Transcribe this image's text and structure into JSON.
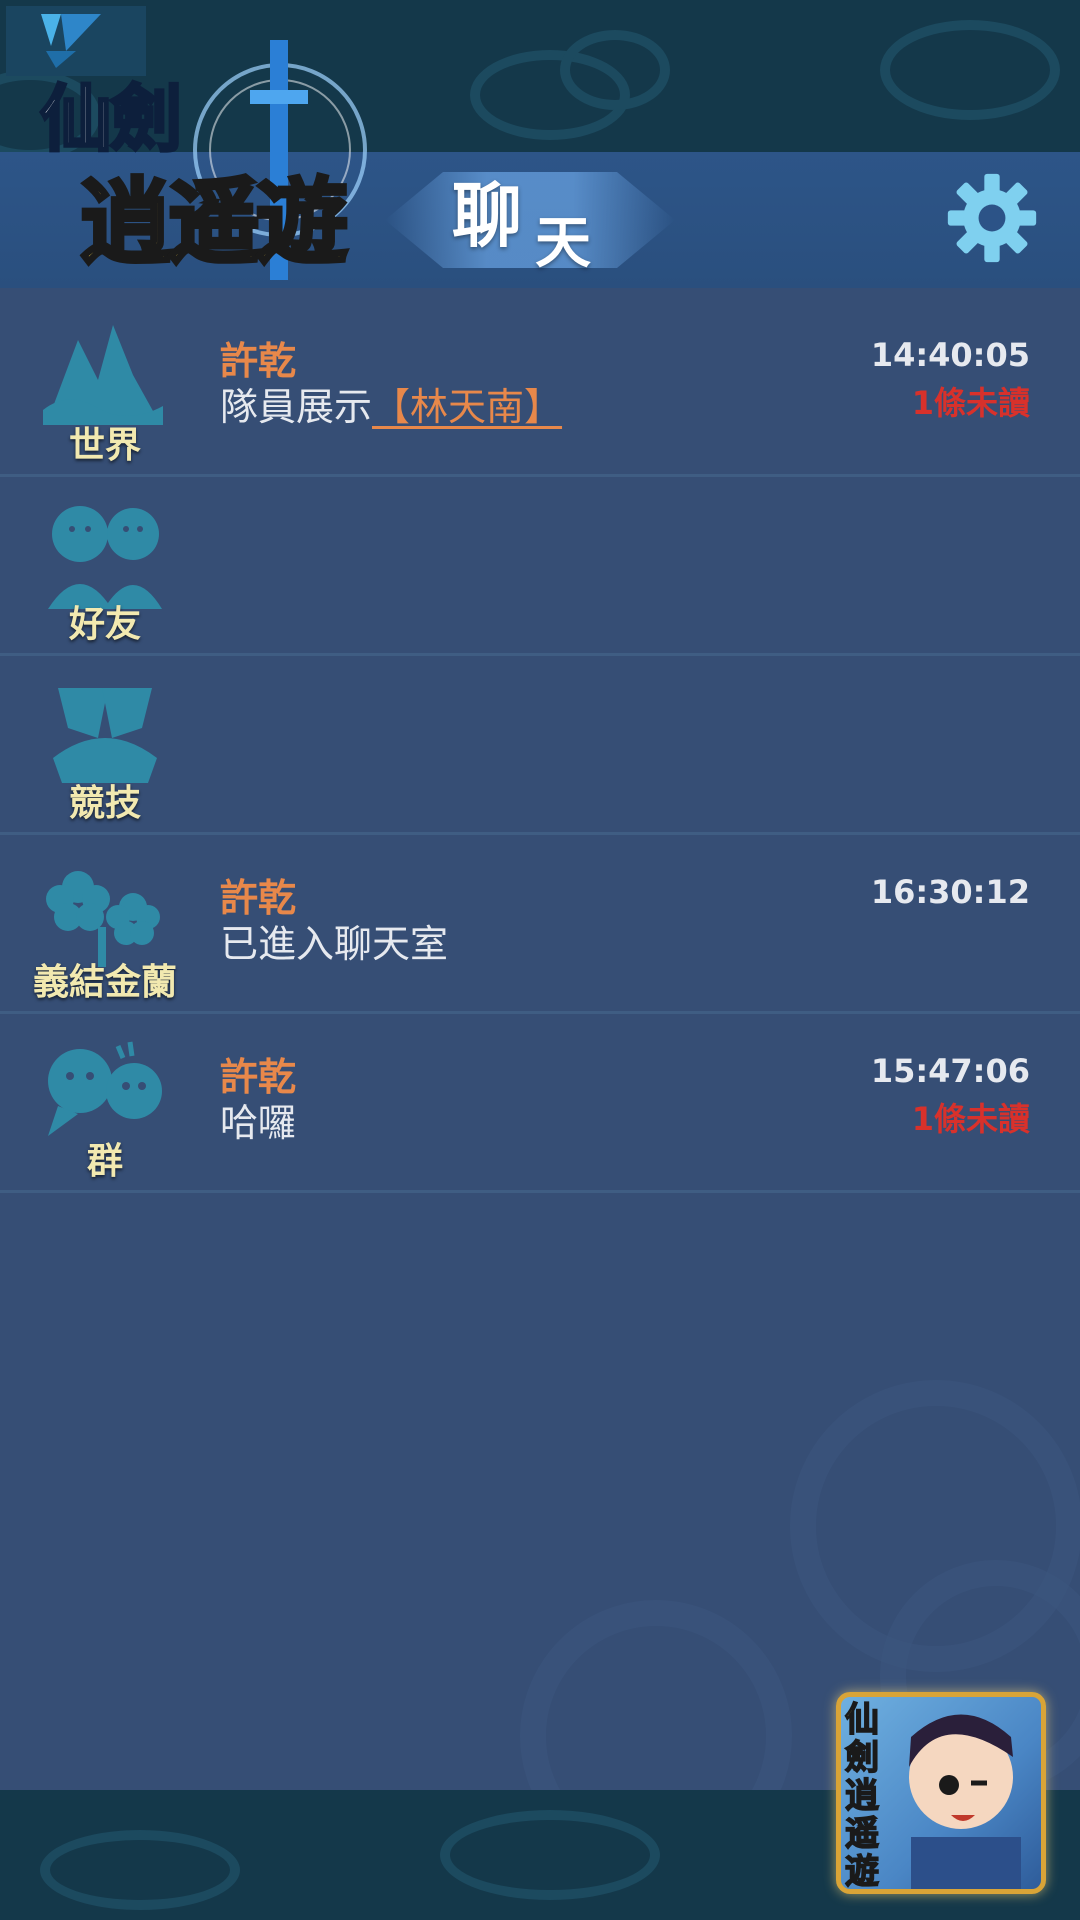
{
  "header": {
    "title_part1": "聊",
    "title_part2": "天",
    "settings_icon": "gear-icon"
  },
  "logo": {
    "line1": "仙劍",
    "line2": "逍遥遊"
  },
  "channels": [
    {
      "label": "世界",
      "icon": "mountain-icon",
      "sender": "許乾",
      "message_prefix": "隊員展示",
      "message_tag": "【林天南】",
      "time": "14:40:05",
      "unread": "1條未讀"
    },
    {
      "label": "好友",
      "icon": "friends-icon"
    },
    {
      "label": "競技",
      "icon": "crossed-swords-icon"
    },
    {
      "label": "義結金蘭",
      "icon": "flowers-icon",
      "sender": "許乾",
      "message": "已進入聊天室",
      "time": "16:30:12"
    },
    {
      "label": "群",
      "icon": "group-chat-icon",
      "sender": "許乾",
      "message": "哈囉",
      "time": "15:47:06",
      "unread": "1條未讀"
    }
  ],
  "app_icon": {
    "text": "仙劍逍遥遊"
  },
  "colors": {
    "background": "#364e75",
    "header": "#2d5588",
    "sender": "#e8884a",
    "unread": "#d8312b",
    "label": "#f2e9b0"
  }
}
